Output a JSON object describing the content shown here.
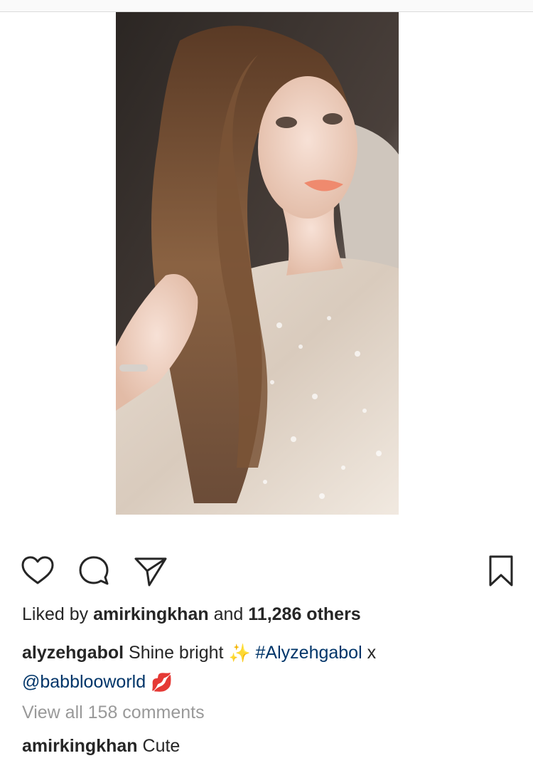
{
  "post": {
    "image_alt": "Selfie of a woman with long brown hair wearing an embellished sheer dress"
  },
  "actions": {
    "like_icon": "heart-outline",
    "comment_icon": "speech-bubble",
    "share_icon": "paper-plane",
    "save_icon": "bookmark"
  },
  "likes": {
    "prefix": "Liked by",
    "user": "amirkingkhan",
    "joiner": "and",
    "count": "11,286 others"
  },
  "caption": {
    "username": "alyzehgabol",
    "text": "Shine bright",
    "sparkles_emoji": "✨",
    "hashtag": "#Alyzehgabol",
    "separator": "x",
    "mention": "@babblooworld",
    "lips_emoji": "💋"
  },
  "comments": {
    "view_all": "View all 158 comments",
    "items": [
      {
        "username": "amirkingkhan",
        "text": "Cute"
      }
    ]
  },
  "colors": {
    "text": "#262626",
    "link": "#003569",
    "muted": "#999999"
  }
}
